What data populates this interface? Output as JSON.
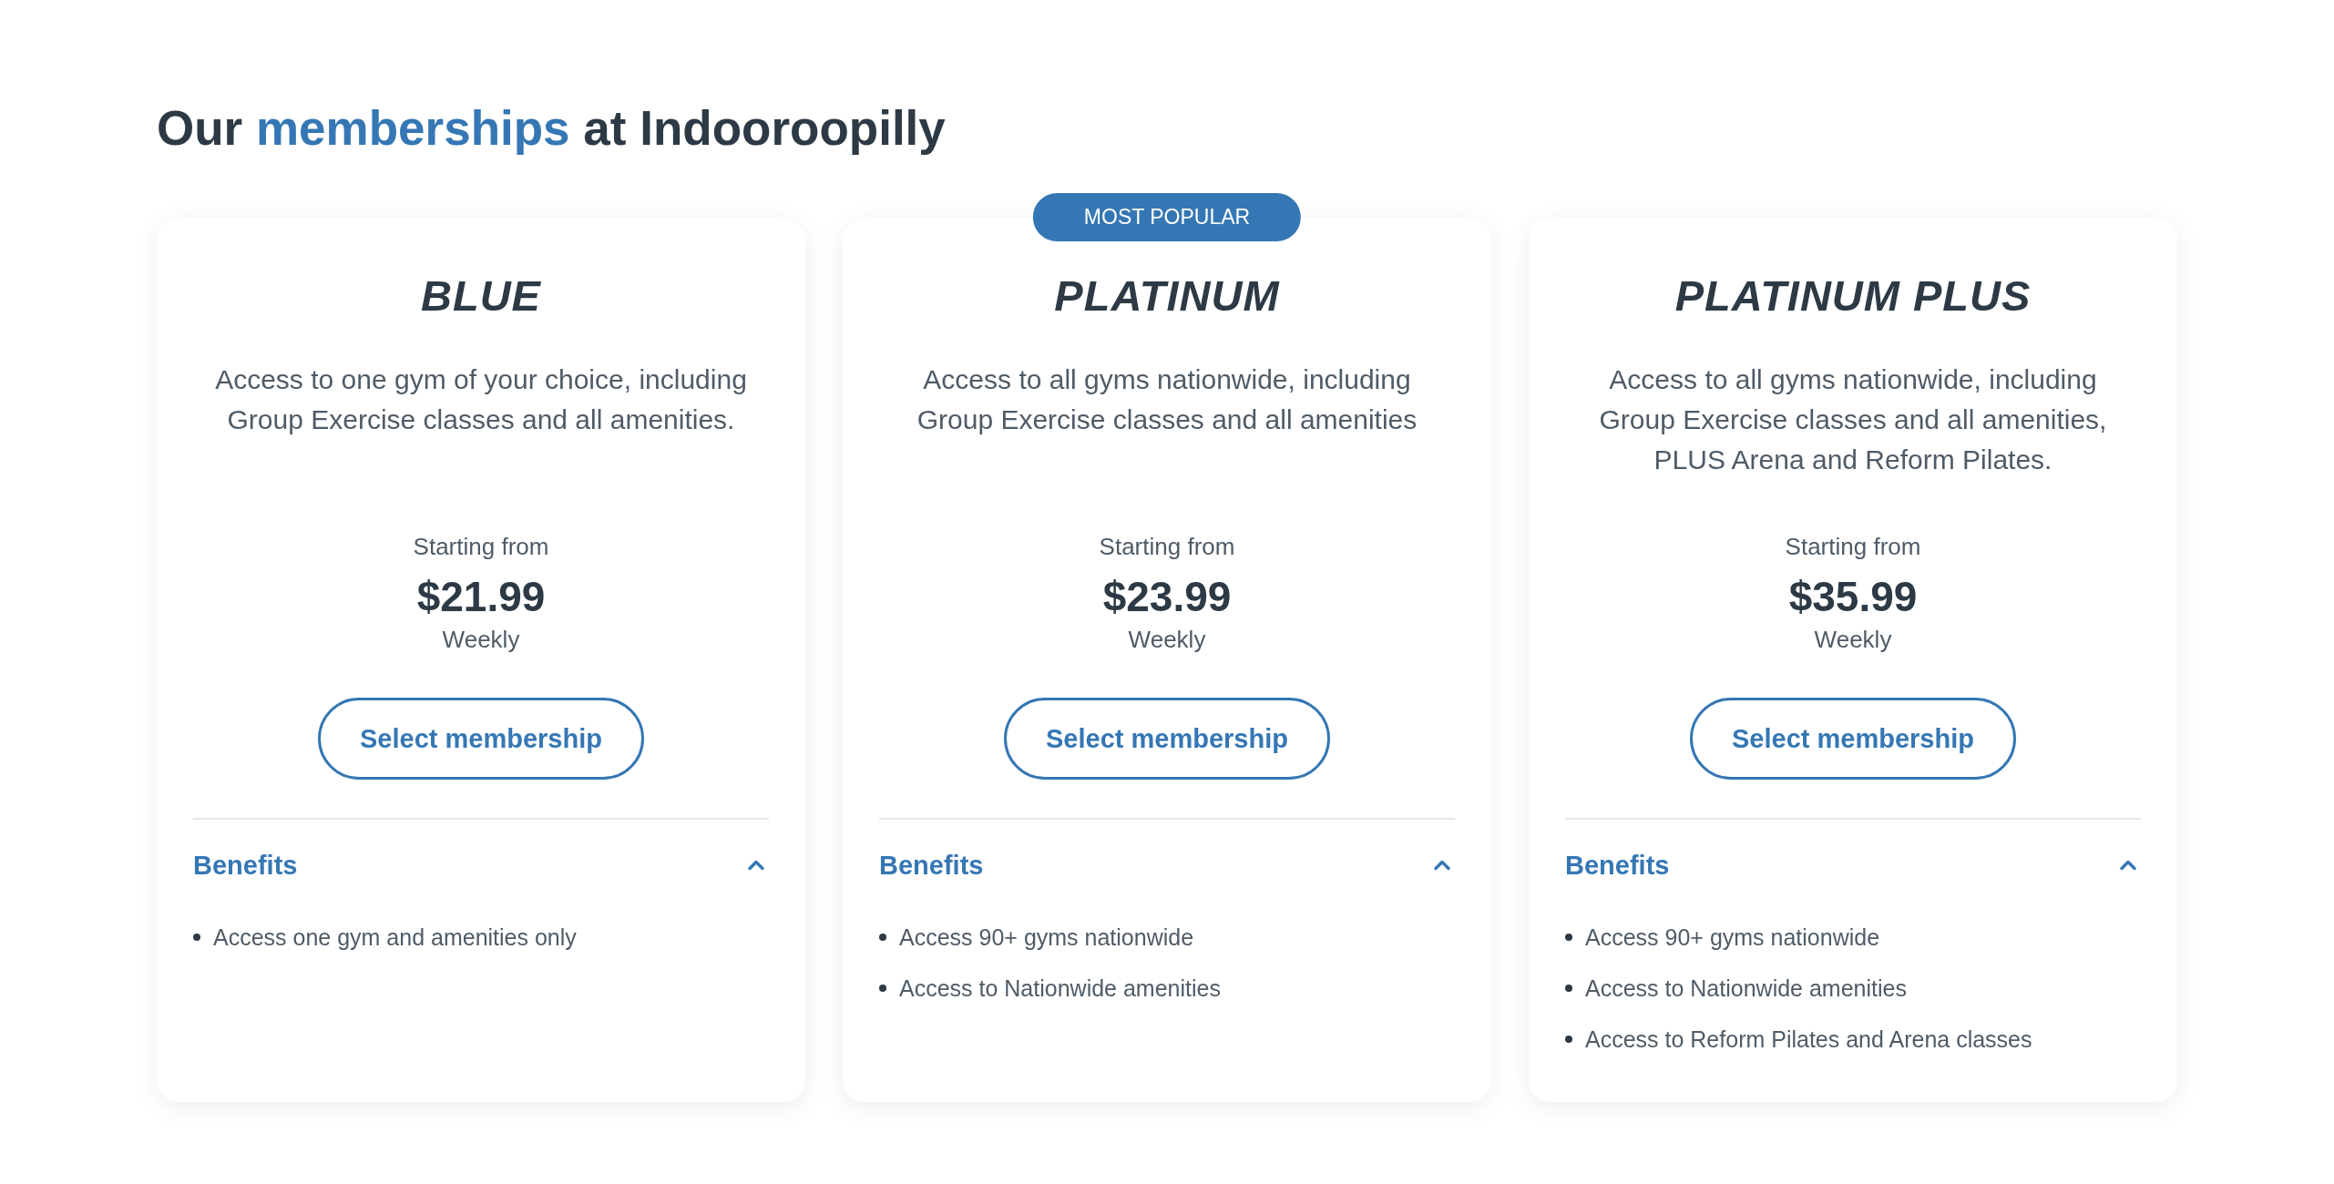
{
  "heading": [
    {
      "text": "Our",
      "highlight": false
    },
    {
      "text": "memberships",
      "highlight": true
    },
    {
      "text": "at Indooroopilly",
      "highlight": false
    }
  ],
  "plans": [
    {
      "name": "BLUE",
      "description": "Access to one gym of your choice, including Group Exercise classes and all amenities.",
      "starting_label": "Starting from",
      "price": "$21.99",
      "period": "Weekly",
      "button": "Select membership",
      "benefits": {
        "title": "Benefits",
        "expanded": true,
        "items": [
          "Access one gym and amenities only"
        ]
      }
    },
    {
      "badge": "MOST POPULAR",
      "name": "PLATINUM",
      "description": "Access to all gyms nationwide, including Group Exercise classes and all amenities",
      "starting_label": "Starting from",
      "price": "$23.99",
      "period": "Weekly",
      "button": "Select membership",
      "benefits": {
        "title": "Benefits",
        "expanded": true,
        "items": [
          "Access 90+ gyms nationwide",
          "Access to Nationwide amenities"
        ]
      }
    },
    {
      "name": "PLATINUM PLUS",
      "description": "Access to all gyms nationwide, including Group Exercise classes and all amenities, PLUS Arena and Reform Pilates.",
      "starting_label": "Starting from",
      "price": "$35.99",
      "period": "Weekly",
      "button": "Select membership",
      "benefits": {
        "title": "Benefits",
        "expanded": true,
        "items": [
          "Access 90+ gyms nationwide",
          "Access to Nationwide amenities",
          "Access to Reform Pilates and Arena classes"
        ]
      }
    }
  ]
}
